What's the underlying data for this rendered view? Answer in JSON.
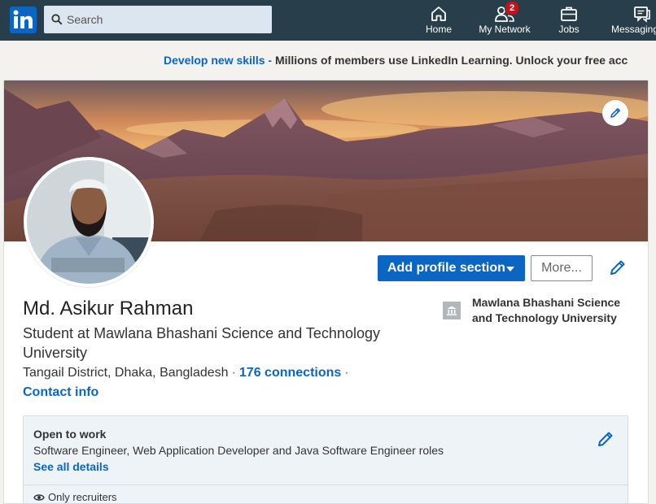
{
  "nav": {
    "search_placeholder": "Search",
    "items": [
      {
        "label": "Home",
        "icon": "home-icon"
      },
      {
        "label": "My Network",
        "icon": "network-icon",
        "badge": "2"
      },
      {
        "label": "Jobs",
        "icon": "jobs-icon"
      },
      {
        "label": "Messaging",
        "icon": "messaging-icon"
      }
    ]
  },
  "promo": {
    "link_text": "Develop new skills",
    "separator": " - ",
    "text": "Millions of members use LinkedIn Learning. Unlock your free acc"
  },
  "profile": {
    "add_section_label": "Add profile section",
    "more_label": "More...",
    "name": "Md. Asikur Rahman",
    "headline": "Student at Mawlana Bhashani Science and Technology University",
    "location": "Tangail District, Dhaka, Bangladesh",
    "connections": "176 connections",
    "contact_info": "Contact info",
    "education": "Mawlana Bhashani Science and Technology University"
  },
  "open_to_work": {
    "title": "Open to work",
    "roles": "Software Engineer, Web Application Developer and Java Software Engineer roles",
    "see_all": "See all details",
    "visibility": "Only recruiters"
  },
  "colors": {
    "nav_bg": "#283e4a",
    "brand_blue": "#0a66c2",
    "badge_red": "#cc1016",
    "otw_bg": "#eef3f8"
  }
}
